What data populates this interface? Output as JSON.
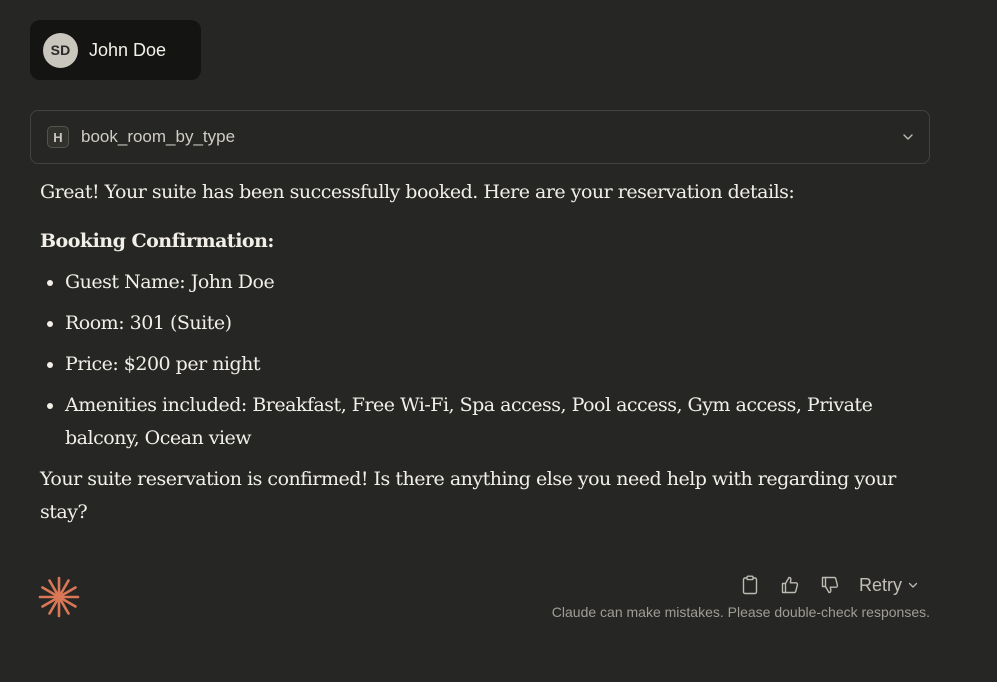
{
  "user": {
    "initials": "SD",
    "name": "John Doe"
  },
  "tool_call": {
    "icon_letter": "H",
    "name": "book_room_by_type",
    "chevron_icon": "chevron-down-icon"
  },
  "response": {
    "intro": "Great! Your suite has been successfully booked. Here are your reservation details:",
    "heading": "Booking Confirmation:",
    "items": [
      "Guest Name: John Doe",
      "Room: 301 (Suite)",
      "Price: $200 per night",
      "Amenities included: Breakfast, Free Wi-Fi, Spa access, Pool access, Gym access, Private balcony, Ocean view"
    ],
    "closing": "Your suite reservation is confirmed! Is there anything else you need help with regarding your stay?"
  },
  "actions": {
    "copy_icon": "clipboard-icon",
    "thumbs_up_icon": "thumbs-up-icon",
    "thumbs_down_icon": "thumbs-down-icon",
    "retry_label": "Retry"
  },
  "footer": {
    "disclaimer": "Claude can make mistakes. Please double-check responses."
  },
  "colors": {
    "background": "#262624",
    "user_chip": "#141413",
    "logo_accent": "#d97757",
    "text": "#f2efe8",
    "muted_text": "#a09d95"
  }
}
